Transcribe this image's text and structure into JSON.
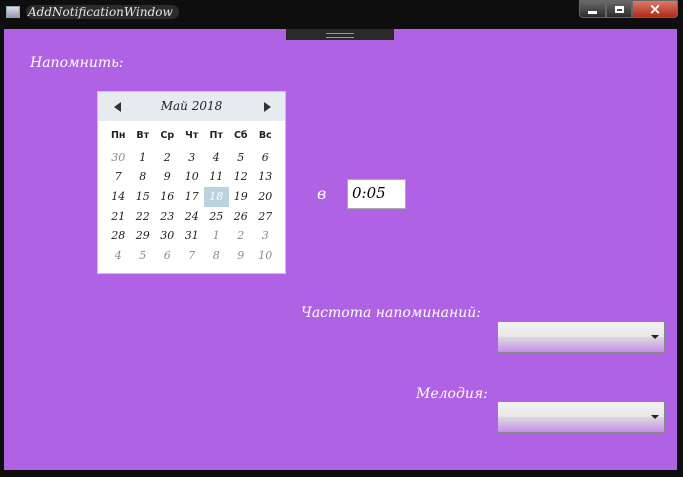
{
  "window": {
    "title": "AddNotificationWindow",
    "buttons": {
      "minimize": "minimize-icon",
      "maximize": "maximize-icon",
      "close": "×"
    },
    "background": "#b062e4"
  },
  "form": {
    "remind_label": "Напомнить:",
    "at_label": "в",
    "time_value": "0:05",
    "frequency_label": "Частота напоминаний:",
    "frequency_value": "",
    "melody_label": "Мелодия:",
    "melody_value": ""
  },
  "calendar": {
    "month_title": "Май 2018",
    "weekdays": [
      "Пн",
      "Вт",
      "Ср",
      "Чт",
      "Пт",
      "Сб",
      "Вс"
    ],
    "days": [
      {
        "d": "30",
        "other": true
      },
      {
        "d": "1"
      },
      {
        "d": "2"
      },
      {
        "d": "3"
      },
      {
        "d": "4"
      },
      {
        "d": "5"
      },
      {
        "d": "6"
      },
      {
        "d": "7"
      },
      {
        "d": "8"
      },
      {
        "d": "9"
      },
      {
        "d": "10"
      },
      {
        "d": "11"
      },
      {
        "d": "12"
      },
      {
        "d": "13"
      },
      {
        "d": "14"
      },
      {
        "d": "15"
      },
      {
        "d": "16"
      },
      {
        "d": "17"
      },
      {
        "d": "18",
        "today": true
      },
      {
        "d": "19"
      },
      {
        "d": "20"
      },
      {
        "d": "21"
      },
      {
        "d": "22"
      },
      {
        "d": "23"
      },
      {
        "d": "24"
      },
      {
        "d": "25"
      },
      {
        "d": "26"
      },
      {
        "d": "27"
      },
      {
        "d": "28"
      },
      {
        "d": "29"
      },
      {
        "d": "30"
      },
      {
        "d": "31"
      },
      {
        "d": "1",
        "other": true
      },
      {
        "d": "2",
        "other": true
      },
      {
        "d": "3",
        "other": true
      },
      {
        "d": "4",
        "other": true
      },
      {
        "d": "5",
        "other": true
      },
      {
        "d": "6",
        "other": true
      },
      {
        "d": "7",
        "other": true
      },
      {
        "d": "8",
        "other": true
      },
      {
        "d": "9",
        "other": true
      },
      {
        "d": "10",
        "other": true
      }
    ],
    "today_color": "#b9d3df"
  }
}
